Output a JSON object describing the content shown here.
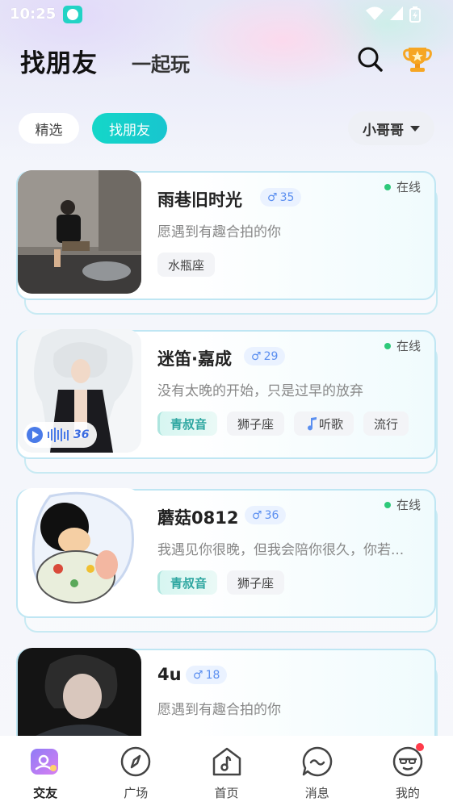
{
  "status_bar": {
    "time": "10:25"
  },
  "header": {
    "title_main": "找朋友",
    "title_second": "一起玩"
  },
  "filters": {
    "chips": [
      {
        "label": "精选",
        "active": false
      },
      {
        "label": "找朋友",
        "active": true
      }
    ],
    "gender_select": "小哥哥"
  },
  "profiles": [
    {
      "name": "雨巷旧时光",
      "age": "35",
      "gender_symbol": "♂",
      "online": "在线",
      "bio": "愿遇到有趣合拍的你",
      "tags": [
        "水瓶座"
      ],
      "voice_tag": "",
      "voice_seconds": ""
    },
    {
      "name": "迷笛·嘉成",
      "age": "29",
      "gender_symbol": "♂",
      "online": "在线",
      "bio": "没有太晚的开始，只是过早的放弃",
      "tags": [
        "狮子座",
        "听歌",
        "流行"
      ],
      "voice_tag": "青叔音",
      "voice_seconds": "36"
    },
    {
      "name": "蘑菇0812",
      "age": "36",
      "gender_symbol": "♂",
      "online": "在线",
      "bio": "我遇见你很晚，但我会陪你很久，你若...",
      "tags": [
        "狮子座"
      ],
      "voice_tag": "青叔音",
      "voice_seconds": ""
    },
    {
      "name": "4u",
      "age": "18",
      "gender_symbol": "♂",
      "online": "",
      "bio": "愿遇到有趣合拍的你",
      "tags": [],
      "voice_tag": "",
      "voice_seconds": ""
    }
  ],
  "nav": {
    "items": [
      {
        "label": "交友",
        "icon": "friends-icon",
        "active": true
      },
      {
        "label": "广场",
        "icon": "compass-icon",
        "active": false
      },
      {
        "label": "首页",
        "icon": "home-music-icon",
        "active": false
      },
      {
        "label": "消息",
        "icon": "message-icon",
        "active": false
      },
      {
        "label": "我的",
        "icon": "profile-icon",
        "active": false
      }
    ]
  },
  "colors": {
    "accent": "#14d7c8",
    "online": "#2dc97a",
    "badge_blue": "#5b8ff0",
    "notify": "#ff3b4a"
  }
}
